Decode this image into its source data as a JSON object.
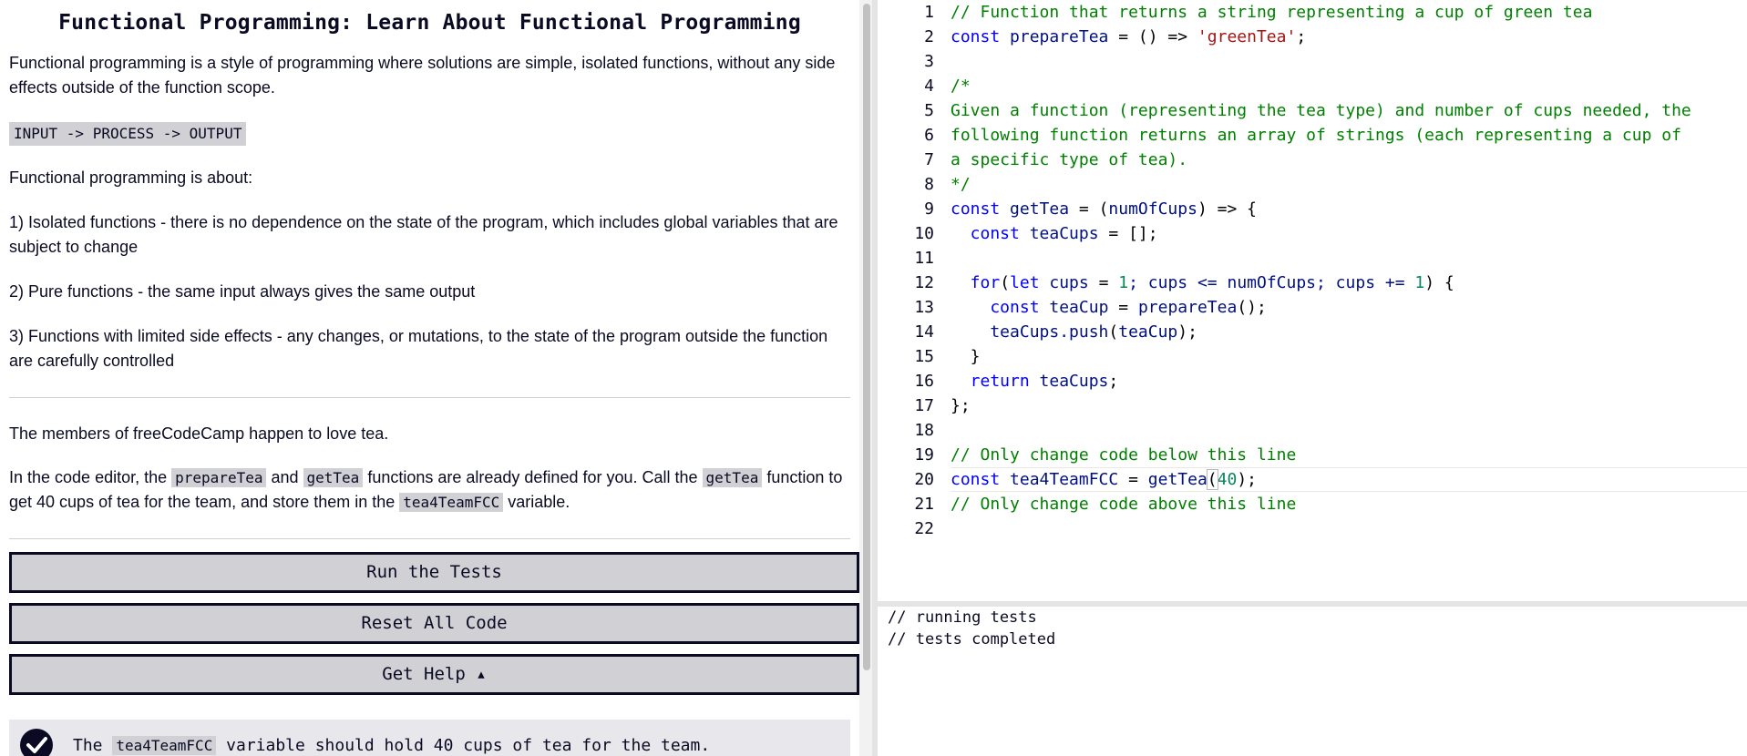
{
  "challenge": {
    "title": "Functional Programming: Learn About Functional Programming",
    "intro": "Functional programming is a style of programming where solutions are simple, isolated functions, without any side effects outside of the function scope.",
    "flow": "INPUT -> PROCESS -> OUTPUT",
    "about_heading": "Functional programming is about:",
    "point1": "1) Isolated functions - there is no dependence on the state of the program, which includes global variables that are subject to change",
    "point2": "2) Pure functions - the same input always gives the same output",
    "point3": "3) Functions with limited side effects - any changes, or mutations, to the state of the program outside the function are carefully controlled",
    "members": "The members of freeCodeCamp happen to love tea.",
    "instr": {
      "t1": "In the code editor, the ",
      "c1": "prepareTea",
      "t2": " and ",
      "c2": "getTea",
      "t3": " functions are already defined for you. Call the ",
      "c3": "getTea",
      "t4": " function to get 40 cups of tea for the team, and store them in the ",
      "c4": "tea4TeamFCC",
      "t5": " variable."
    }
  },
  "buttons": {
    "run": "Run the Tests",
    "reset": "Reset All Code",
    "help": "Get Help ▴"
  },
  "test": {
    "t1": "The ",
    "c1": "tea4TeamFCC",
    "t2": " variable should hold 40 cups of tea for the team."
  },
  "editor": {
    "line_numbers": [
      "1",
      "2",
      "3",
      "4",
      "5",
      "6",
      "7",
      "8",
      "9",
      "10",
      "11",
      "12",
      "13",
      "14",
      "15",
      "16",
      "17",
      "18",
      "19",
      "20",
      "21",
      "22"
    ],
    "l1": "// Function that returns a string representing a cup of green tea",
    "l2": {
      "a": "const",
      "b": " prepareTea ",
      "c": "= () =>",
      "d": " 'greenTea'",
      "e": ";"
    },
    "l4": "/*",
    "l5": "Given a function (representing the tea type) and number of cups needed, the",
    "l6": "following function returns an array of strings (each representing a cup of",
    "l7": "a specific type of tea).",
    "l8": "*/",
    "l9": {
      "a": "const",
      "b": " getTea ",
      "c": "= (",
      "d": "numOfCups",
      "e": ") => {"
    },
    "l10": {
      "a": "  const",
      "b": " teaCups ",
      "c": "= [];"
    },
    "l12": {
      "a": "  for",
      "b": "(",
      "c": "let",
      "d": " cups ",
      "e": "= ",
      "f": "1",
      "g": "; cups <= numOfCups; cups += ",
      "h": "1",
      "i": ") {"
    },
    "l13": {
      "a": "    const",
      "b": " teaCup ",
      "c": "= ",
      "d": "prepareTea",
      "e": "();"
    },
    "l14": {
      "a": "    teaCups.push",
      "b": "(",
      "c": "teaCup",
      "d": ");"
    },
    "l15": "  }",
    "l16": {
      "a": "  return",
      "b": " teaCups",
      "c": ";"
    },
    "l17": "};",
    "l19": "// Only change code below this line",
    "l20": {
      "a": "const",
      "b": " tea4TeamFCC ",
      "c": "= ",
      "d": "getTea",
      "e": "(",
      "f": "40",
      "g": ");"
    },
    "l21": "// Only change code above this line"
  },
  "console": {
    "line1": "// running tests",
    "line2": "// tests completed"
  },
  "colors": {
    "comment": "#008000",
    "keyword": "#0000ff",
    "string": "#a31515",
    "number": "#098658",
    "identifier": "#001080",
    "button_bg": "#d0d0d5",
    "text": "#0a0a23"
  }
}
